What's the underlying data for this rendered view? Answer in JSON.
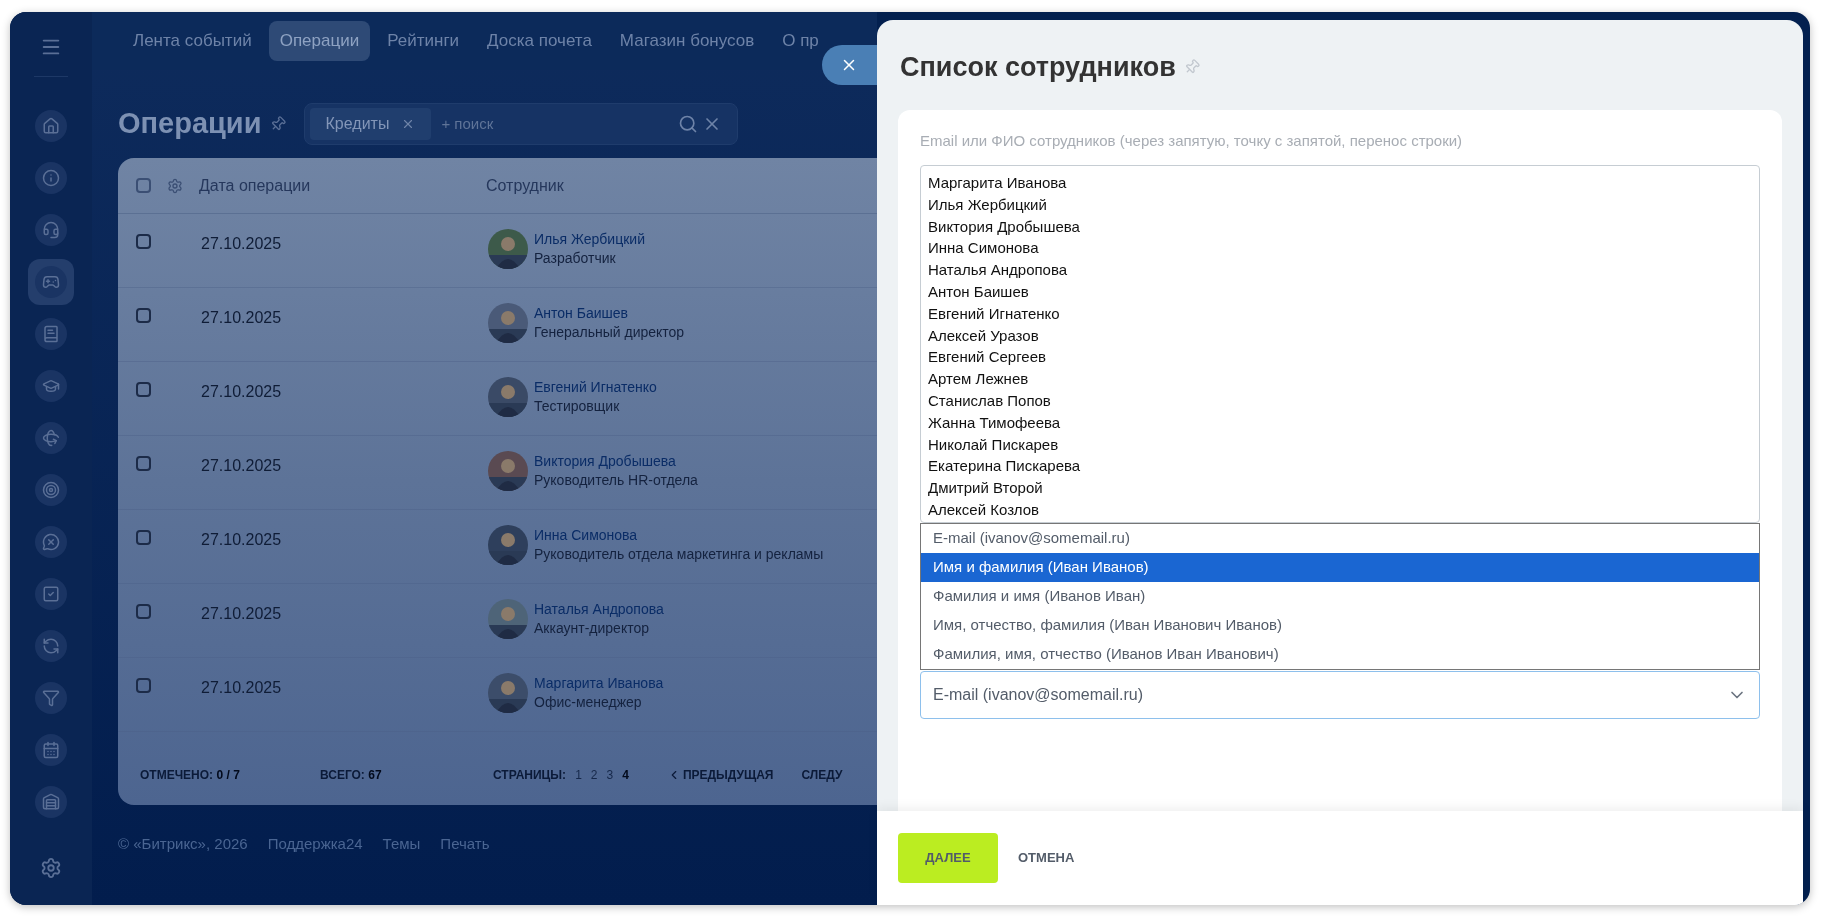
{
  "sidebar": {
    "items": [
      {
        "kind": "menu",
        "selected": false
      },
      {
        "kind": "home",
        "selected": false
      },
      {
        "kind": "info",
        "selected": false
      },
      {
        "kind": "support",
        "selected": false
      },
      {
        "kind": "games",
        "selected": true
      },
      {
        "kind": "book",
        "selected": false
      },
      {
        "kind": "education",
        "selected": false
      },
      {
        "kind": "rotate",
        "selected": false
      },
      {
        "kind": "target",
        "selected": false
      },
      {
        "kind": "chat",
        "selected": false
      },
      {
        "kind": "tasks",
        "selected": false
      },
      {
        "kind": "sync",
        "selected": false
      },
      {
        "kind": "filter",
        "selected": false
      },
      {
        "kind": "calendar",
        "selected": false
      },
      {
        "kind": "warehouse",
        "selected": false
      },
      {
        "kind": "settings",
        "selected": false
      }
    ]
  },
  "top_nav": {
    "tabs": [
      {
        "label": "Лента событий",
        "selected": false
      },
      {
        "label": "Операции",
        "selected": true
      },
      {
        "label": "Рейтинги",
        "selected": false
      },
      {
        "label": "Доска почета",
        "selected": false
      },
      {
        "label": "Магазин бонусов",
        "selected": false
      },
      {
        "label": "О пр",
        "selected": false
      }
    ]
  },
  "page": {
    "title": "Операции",
    "filter": {
      "tags": [
        "Кредиты"
      ],
      "placeholder": "+ поиск"
    }
  },
  "table": {
    "columns": [
      "Дата операции",
      "Сотрудник"
    ],
    "all_checked": false,
    "rows": [
      {
        "date": "27.10.2025",
        "name": "Илья Жербицкий",
        "position": "Разработчик",
        "checked": false
      },
      {
        "date": "27.10.2025",
        "name": "Антон Баишев",
        "position": "Генеральный директор",
        "checked": false
      },
      {
        "date": "27.10.2025",
        "name": "Евгений Игнатенко",
        "position": "Тестировщик",
        "checked": false
      },
      {
        "date": "27.10.2025",
        "name": "Виктория Дробышева",
        "position": "Руководитель HR-отдела",
        "checked": false
      },
      {
        "date": "27.10.2025",
        "name": "Инна Симонова",
        "position": "Руководитель отдела маркетинга и рекламы",
        "checked": false
      },
      {
        "date": "27.10.2025",
        "name": "Наталья Андропова",
        "position": "Аккаунт-директор",
        "checked": false
      },
      {
        "date": "27.10.2025",
        "name": "Маргарита Иванова",
        "position": "Офис-менеджер",
        "checked": false
      }
    ],
    "footer": {
      "selected_label": "ОТМЕЧЕНО:",
      "selected_value": "0 / 7",
      "total_label": "ВСЕГО:",
      "total_value": "67",
      "pages_label": "СТРАНИЦЫ:",
      "pages": [
        {
          "label": "1",
          "selected": false
        },
        {
          "label": "2",
          "selected": false
        },
        {
          "label": "3",
          "selected": false
        },
        {
          "label": "4",
          "selected": true
        }
      ],
      "prev": "ПРЕДЫДУЩАЯ",
      "next": "СЛЕДУ"
    }
  },
  "footer_links": [
    "© «Битрикс», 2026",
    "Поддержка24",
    "Темы",
    "Печать"
  ],
  "panel": {
    "title": "Список сотрудников",
    "field_label": "Email или ФИО сотрудников (через запятую, точку с запятой, перенос строки)",
    "names": [
      "Маргарита Иванова",
      "Илья Жербицкий",
      "Виктория Дробышева",
      "Инна Симонова",
      "Наталья Андропова",
      "Антон Баишев",
      "Евгений Игнатенко",
      "Алексей Уразов",
      "Евгений Сергеев",
      "Артем Лежнев",
      "Станислав Попов",
      "Жанна Тимофеева",
      "Николай Пискарев",
      "Екатерина Пискарева",
      "Дмитрий Второй",
      "Алексей Козлов"
    ],
    "format_options": [
      {
        "label": "E-mail (ivanov@somemail.ru)",
        "selected": false
      },
      {
        "label": "Имя и фамилия (Иван Иванов)",
        "selected": true
      },
      {
        "label": "Фамилия и имя (Иванов Иван)",
        "selected": false
      },
      {
        "label": "Имя, отчество, фамилия (Иван Иванович Иванов)",
        "selected": false
      },
      {
        "label": "Фамилия, имя, отчество (Иванов Иван Иванович)",
        "selected": false
      }
    ],
    "format_value": "E-mail (ivanov@somemail.ru)",
    "buttons": {
      "next": "ДАЛЕЕ",
      "cancel": "ОТМЕНА"
    }
  }
}
